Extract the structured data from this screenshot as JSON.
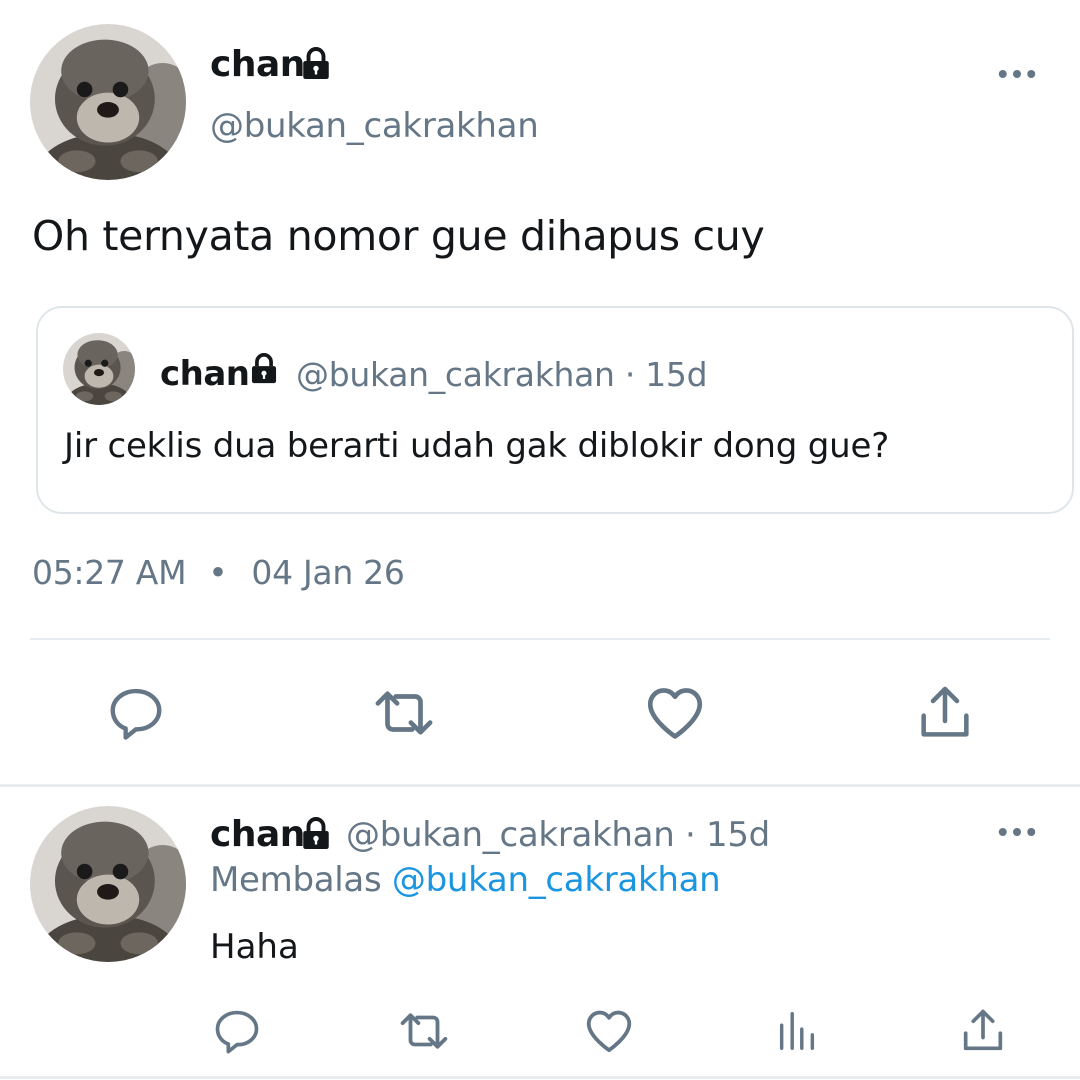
{
  "tweet": {
    "author": {
      "name": "chan",
      "handle": "@bukan_cakrakhan",
      "avatar": "otter-avatar",
      "locked": true
    },
    "text": "Oh ternyata nomor gue dihapus cuy",
    "quoted": {
      "name": "chan",
      "handle": "@bukan_cakrakhan",
      "age": "15d",
      "meta": "@bukan_cakrakhan · 15d",
      "text": "Jir ceklis dua berarti udah gak diblokir dong gue?"
    },
    "time": "05:27 AM",
    "separator": "•",
    "date": "04 Jan 26",
    "actions": [
      "reply-icon",
      "retweet-icon",
      "like-icon",
      "share-icon"
    ]
  },
  "reply": {
    "name": "chan",
    "handle": "@bukan_cakrakhan",
    "meta": "@bukan_cakrakhan · 15d",
    "replying_prefix": "Membalas",
    "replying_to": "@bukan_cakrakhan",
    "text": "Haha",
    "actions": [
      "reply-icon",
      "retweet-icon",
      "like-icon",
      "analytics-icon",
      "share-icon"
    ]
  },
  "colors": {
    "text": "#14171a",
    "secondary": "#657786",
    "link": "#1b95e0",
    "border": "#dfe6ea"
  }
}
